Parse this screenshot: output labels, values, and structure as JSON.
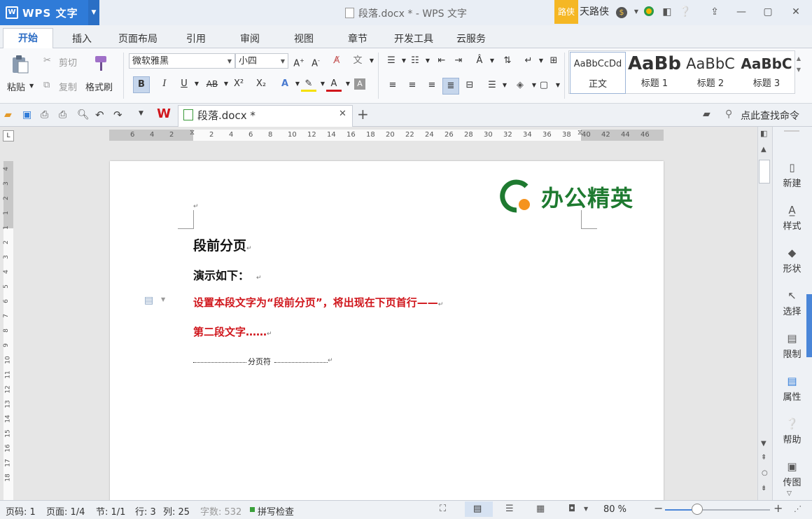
{
  "app": {
    "title": "WPS 文字",
    "logo_letter": "W"
  },
  "window": {
    "doc_title": "段落.docx * - WPS 文字"
  },
  "user": {
    "badge": "路侠",
    "name": "天路侠",
    "coin": "$"
  },
  "menu_tabs": [
    "开始",
    "插入",
    "页面布局",
    "引用",
    "审阅",
    "视图",
    "章节",
    "开发工具",
    "云服务"
  ],
  "ribbon": {
    "paste": "粘贴",
    "cut": "剪切",
    "copy": "复制",
    "format_painter": "格式刷",
    "font_name": "微软雅黑",
    "font_size": "小四",
    "bold": "B",
    "italic": "I",
    "underline": "U",
    "strike": "AB",
    "superscript": "X²",
    "subscript": "X₂",
    "styles": [
      {
        "preview": "AaBbCcDd",
        "name": "正文"
      },
      {
        "preview": "AaBb",
        "name": "标题 1"
      },
      {
        "preview": "AaBbC",
        "name": "标题 2"
      },
      {
        "preview": "AaBbC",
        "name": "标题 3"
      }
    ]
  },
  "doc_tabs": {
    "file": "段落.docx *",
    "search_cmd": "点此查找命令"
  },
  "ruler": {
    "h_left": [
      "6",
      "4",
      "2"
    ],
    "h_right": [
      "2",
      "4",
      "6",
      "8",
      "10",
      "12",
      "14",
      "16",
      "18",
      "20",
      "22",
      "24",
      "26",
      "28",
      "30",
      "32",
      "34",
      "36",
      "38",
      "40",
      "42",
      "44",
      "46"
    ],
    "v": [
      "4",
      "3",
      "2",
      "1",
      "1",
      "2",
      "3",
      "4",
      "5",
      "6",
      "7",
      "8",
      "9",
      "10",
      "11",
      "12",
      "13",
      "14",
      "15",
      "16",
      "17",
      "18"
    ]
  },
  "document": {
    "logo_text": "办公精英",
    "heading": "段前分页",
    "demo": "演示如下：",
    "red_para1": "设置本段文字为“段前分页”，将出现在下页首行——",
    "red_para2": "第二段文字……",
    "page_break": "分页符",
    "para_mark": "↵"
  },
  "right_panel": [
    "新建",
    "样式",
    "形状",
    "选择",
    "限制",
    "属性",
    "帮助",
    "传图"
  ],
  "status": {
    "page_no": "页码: 1",
    "pages": "页面: 1/4",
    "section": "节: 1/1",
    "line": "行: 3",
    "col": "列: 25",
    "words": "字数: 532",
    "spell": "拼写检查",
    "zoom": "80 %"
  },
  "colors": {
    "accent": "#2f7bd8",
    "red_text": "#d0161c",
    "logo_green": "#1e7a30",
    "logo_orange": "#f5931e",
    "badge": "#f5b724"
  }
}
